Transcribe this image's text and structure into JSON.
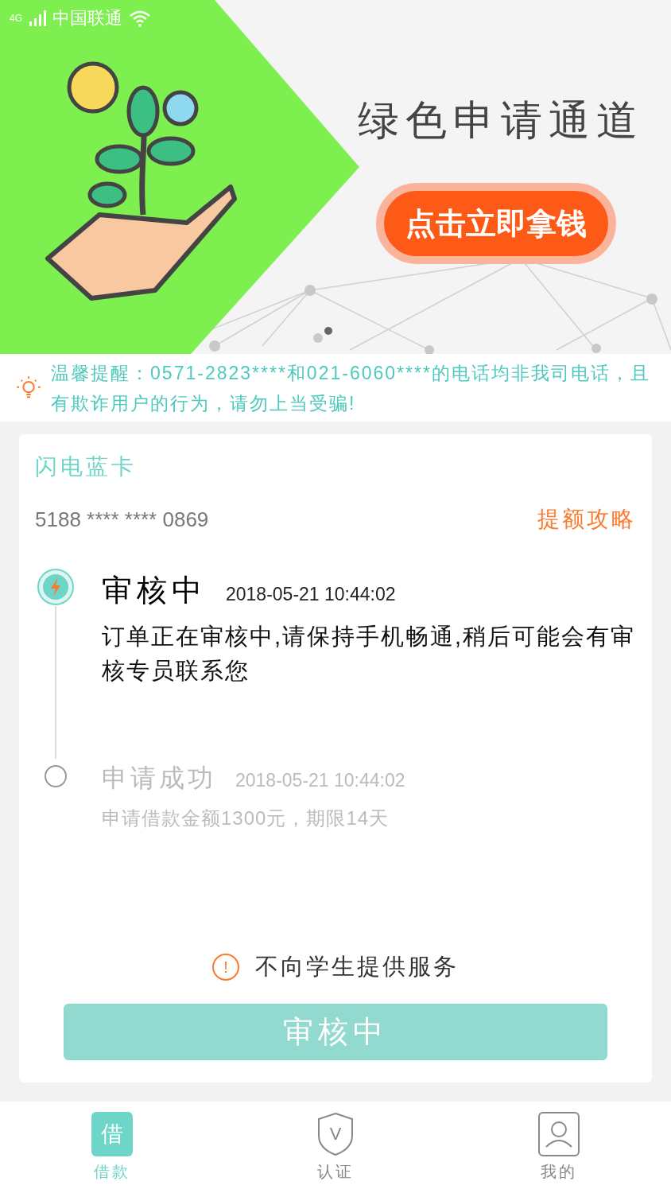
{
  "status_bar": {
    "network": "4G",
    "carrier": "中国联通"
  },
  "banner": {
    "title": "绿色申请通道",
    "button": "点击立即拿钱",
    "pager": [
      {
        "selected": true
      }
    ]
  },
  "notice": {
    "text": "温馨提醒：0571-2823****和021-6060****的电话均非我司电话，且有欺诈用户的行为，请勿上当受骗!"
  },
  "card": {
    "name": "闪电蓝卡",
    "number": "5188 **** **** 0869",
    "link": "提额攻略"
  },
  "timeline": [
    {
      "title": "审核中",
      "time": "2018-05-21 10:44:02",
      "desc": "订单正在审核中,请保持手机畅通,稍后可能会有审核专员联系您",
      "active": true
    },
    {
      "title": "申请成功",
      "time": "2018-05-21 10:44:02",
      "desc": "申请借款金额1300元，期限14天",
      "active": false
    }
  ],
  "warning": {
    "icon": "!",
    "text": "不向学生提供服务"
  },
  "action_button": {
    "label": "审核中",
    "disabled": true
  },
  "tabs": [
    {
      "kind": "loan",
      "icon_text": "借",
      "label": "借款",
      "selected": true
    },
    {
      "kind": "verify",
      "icon_text": "V",
      "label": "认证",
      "selected": false
    },
    {
      "kind": "profile",
      "label": "我的",
      "selected": false
    }
  ]
}
